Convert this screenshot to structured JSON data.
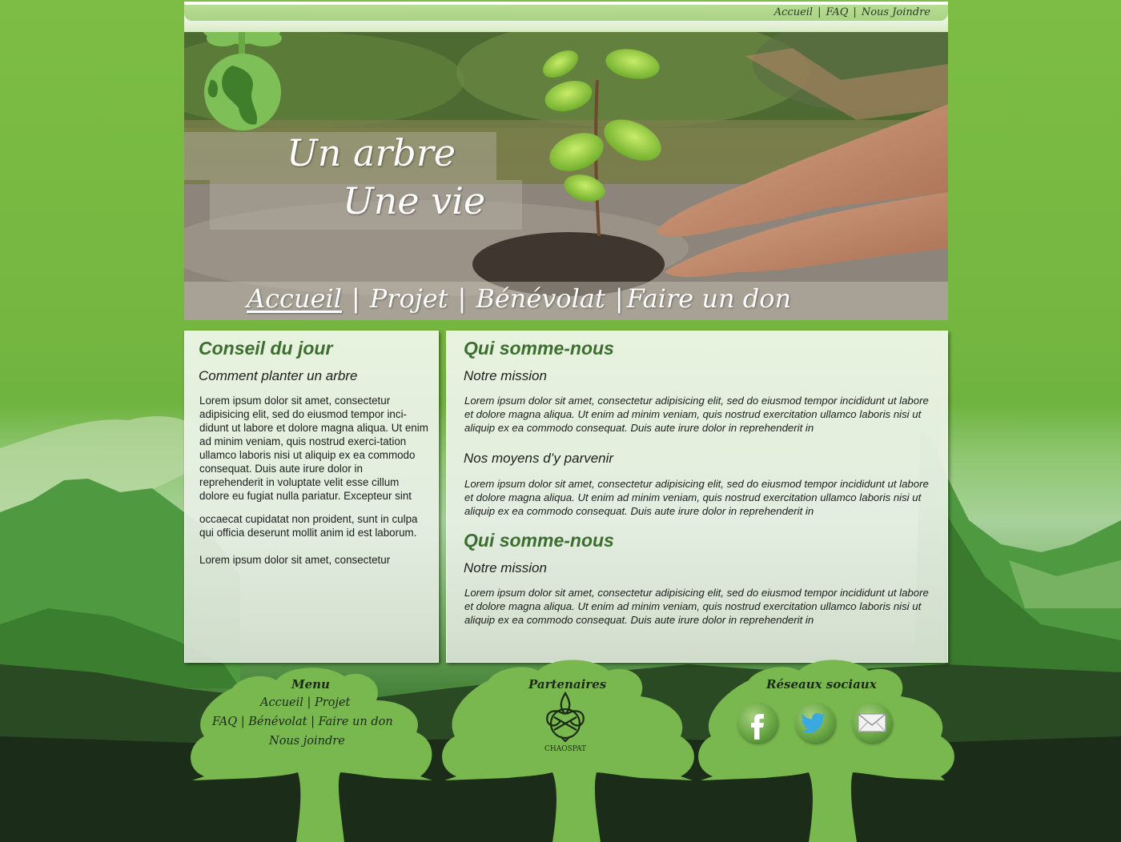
{
  "top_nav": {
    "items": [
      "Accueil",
      "FAQ",
      "Nous Joindre"
    ],
    "separator": "|"
  },
  "hero": {
    "slogan_line1": "Un arbre",
    "slogan_line2": "Une vie",
    "nav": [
      "Accueil",
      "Projet",
      "Bénévolat",
      "Faire un don"
    ],
    "separator": "|"
  },
  "left_panel": {
    "title": "Conseil du jour",
    "subtitle": "Comment planter un arbre",
    "paragraph1": "Lorem ipsum dolor sit amet, consectetur adipisicing elit, sed do eiusmod tempor inci-didunt ut labore et dolore magna aliqua. Ut enim ad minim veniam, quis nostrud exerci-tation ullamco laboris nisi ut aliquip ex ea commodo consequat. Duis aute irure dolor in reprehenderit in voluptate velit esse cillum dolore eu fugiat nulla pariatur. Excepteur sint",
    "paragraph2": "occaecat cupidatat non proident, sunt in culpa qui officia deserunt mollit anim id est laborum.",
    "paragraph3": "Lorem ipsum dolor sit amet, consectetur"
  },
  "right_panel": {
    "section1_title": "Qui somme-nous",
    "section1_sub1": "Notre mission",
    "section1_text1": "Lorem ipsum dolor sit amet, consectetur adipisicing elit, sed do eiusmod tempor incididunt ut labore et dolore magna aliqua. Ut enim ad minim veniam, quis nostrud exercitation ullamco laboris nisi ut aliquip ex ea commodo consequat. Duis aute irure dolor in reprehenderit in",
    "section1_sub2": "Nos moyens d’y parvenir",
    "section1_text2": "Lorem ipsum dolor sit amet, consectetur adipisicing elit, sed do eiusmod tempor incididunt ut labore et dolore magna aliqua. Ut enim ad minim veniam, quis nostrud exercitation ullamco laboris nisi ut aliquip ex ea commodo consequat. Duis aute irure dolor in reprehenderit in",
    "section2_title": "Qui somme-nous",
    "section2_sub1": "Notre mission",
    "section2_text1": "Lorem ipsum dolor sit amet, consectetur adipisicing elit, sed do eiusmod tempor incididunt ut labore et dolore magna aliqua. Ut enim ad minim veniam, quis nostrud exercitation ullamco laboris nisi ut aliquip ex ea commodo consequat. Duis aute irure dolor in reprehenderit in"
  },
  "footer": {
    "menu_title": "Menu",
    "menu_links": [
      "Accueil",
      "Projet",
      "FAQ",
      "Bénévolat",
      "Faire un don",
      "Nous joindre"
    ],
    "separator": "|",
    "partners_title": "Partenaires",
    "partner_name": "CHAOSPAT",
    "social_title": "Réseaux sociaux",
    "social_icons": [
      "facebook-icon",
      "twitter-icon",
      "email-icon"
    ]
  },
  "colors": {
    "background_green": "#74b843",
    "heading_green": "#3c6e2f",
    "tree_green": "#78b84e",
    "dark_forest": "#1b2c18"
  }
}
